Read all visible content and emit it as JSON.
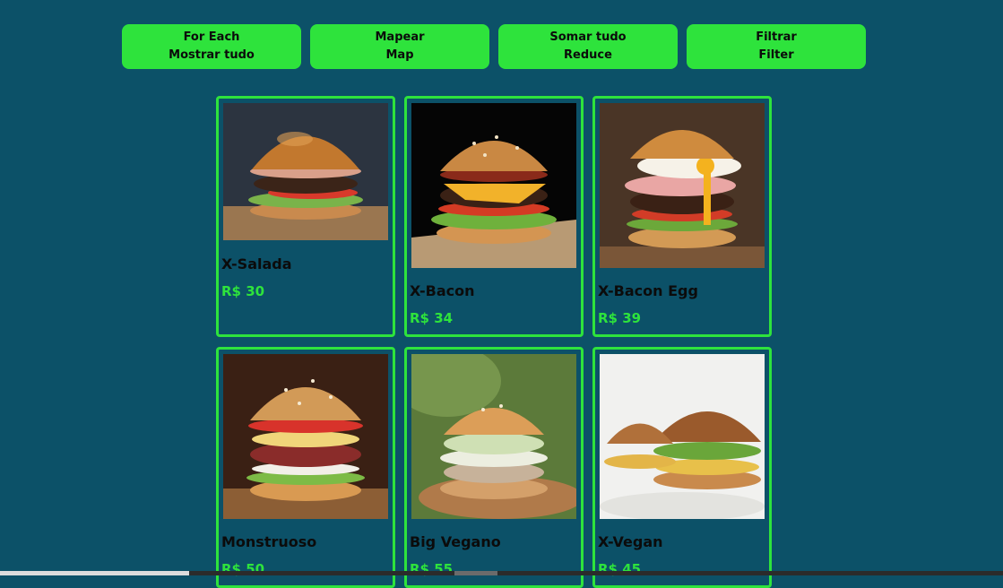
{
  "buttons": [
    {
      "line1": "For Each",
      "line2": "Mostrar tudo"
    },
    {
      "line1": "Mapear",
      "line2": "Map"
    },
    {
      "line1": "Somar tudo",
      "line2": "Reduce"
    },
    {
      "line1": "Filtrar",
      "line2": "Filter"
    }
  ],
  "products": [
    {
      "name": "X-Salada",
      "price": "R$ 30"
    },
    {
      "name": "X-Bacon",
      "price": "R$ 34"
    },
    {
      "name": "X-Bacon Egg",
      "price": "R$ 39"
    },
    {
      "name": "Monstruoso",
      "price": "R$ 50"
    },
    {
      "name": "Big Vegano",
      "price": "R$ 55"
    },
    {
      "name": "X-Vegan",
      "price": "R$ 45"
    }
  ],
  "colors": {
    "background": "#0c5168",
    "accent": "#2ee33c",
    "text": "#0b0b0b"
  }
}
